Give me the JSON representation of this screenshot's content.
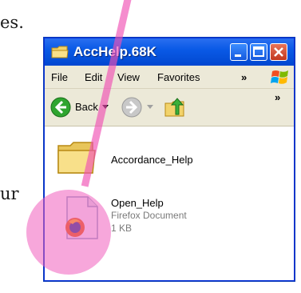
{
  "background_text": [
    "es.",
    "ur"
  ],
  "window": {
    "title": "AccHelp.68K",
    "menu": [
      "File",
      "Edit",
      "View",
      "Favorites"
    ],
    "menu_overflow": "»",
    "toolbar": {
      "back_label": "Back",
      "overflow": "»"
    },
    "files": [
      {
        "name": "Accordance_Help",
        "icon": "folder-icon"
      },
      {
        "name": "Open_Help",
        "type": "Firefox Document",
        "size": "1 KB",
        "icon": "firefox-document-icon"
      }
    ]
  },
  "colors": {
    "titlebar": "#0a5ae6",
    "chrome": "#ece9d8",
    "highlight": "#f050b4"
  }
}
